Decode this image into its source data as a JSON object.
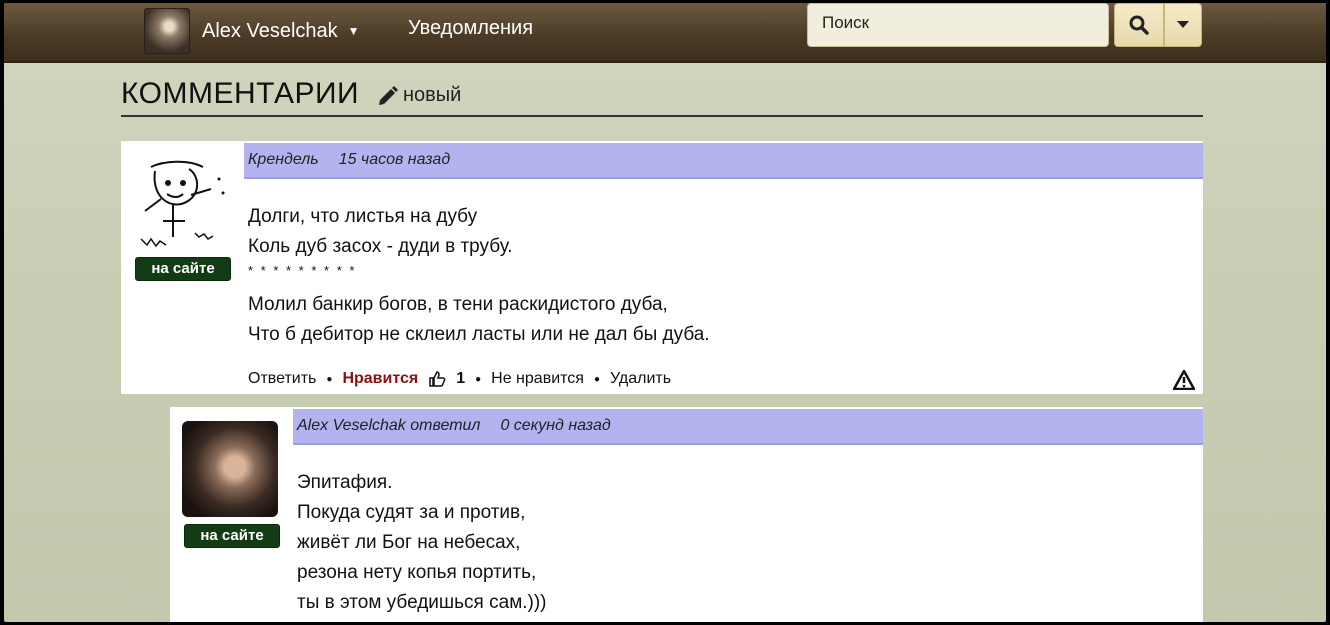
{
  "navbar": {
    "username": "Alex Veselchak",
    "notifications": "Уведомления",
    "search_placeholder": "Поиск"
  },
  "page": {
    "title": "КОММЕНТАРИИ",
    "new_label": "новый"
  },
  "comments": [
    {
      "author": "Крендель",
      "time": "15 часов назад",
      "status": "на сайте",
      "lines": [
        "Долги, что листья на дубу",
        "Коль дуб засох - дуди в трубу."
      ],
      "separator": "* * * * * * * * *",
      "lines2": [
        "Молил банкир богов, в тени раскидистого дуба,",
        "Что б дебитор не склеил ласты или не дал бы дуба."
      ],
      "actions": {
        "reply": "Ответить",
        "like": "Нравится",
        "like_count": "1",
        "dislike": "Не нравится",
        "delete": "Удалить"
      }
    },
    {
      "author": "Alex Veselchak ответил",
      "time": "0 секунд назад",
      "status": "на сайте",
      "lines": [
        "Эпитафия.",
        "Покуда судят за и против,",
        "живёт ли Бог на небесах,",
        "резона нету копья портить,",
        "ты в этом убедишься сам.)))"
      ]
    }
  ],
  "colors": {
    "navbar": "#4a3a25",
    "comment_header": "#b3b4ef",
    "online_badge": "#123d14",
    "like": "#8e1010"
  },
  "icons": [
    "search-icon",
    "chevron-down-icon",
    "pencil-icon",
    "thumbs-up-icon",
    "warning-icon"
  ]
}
